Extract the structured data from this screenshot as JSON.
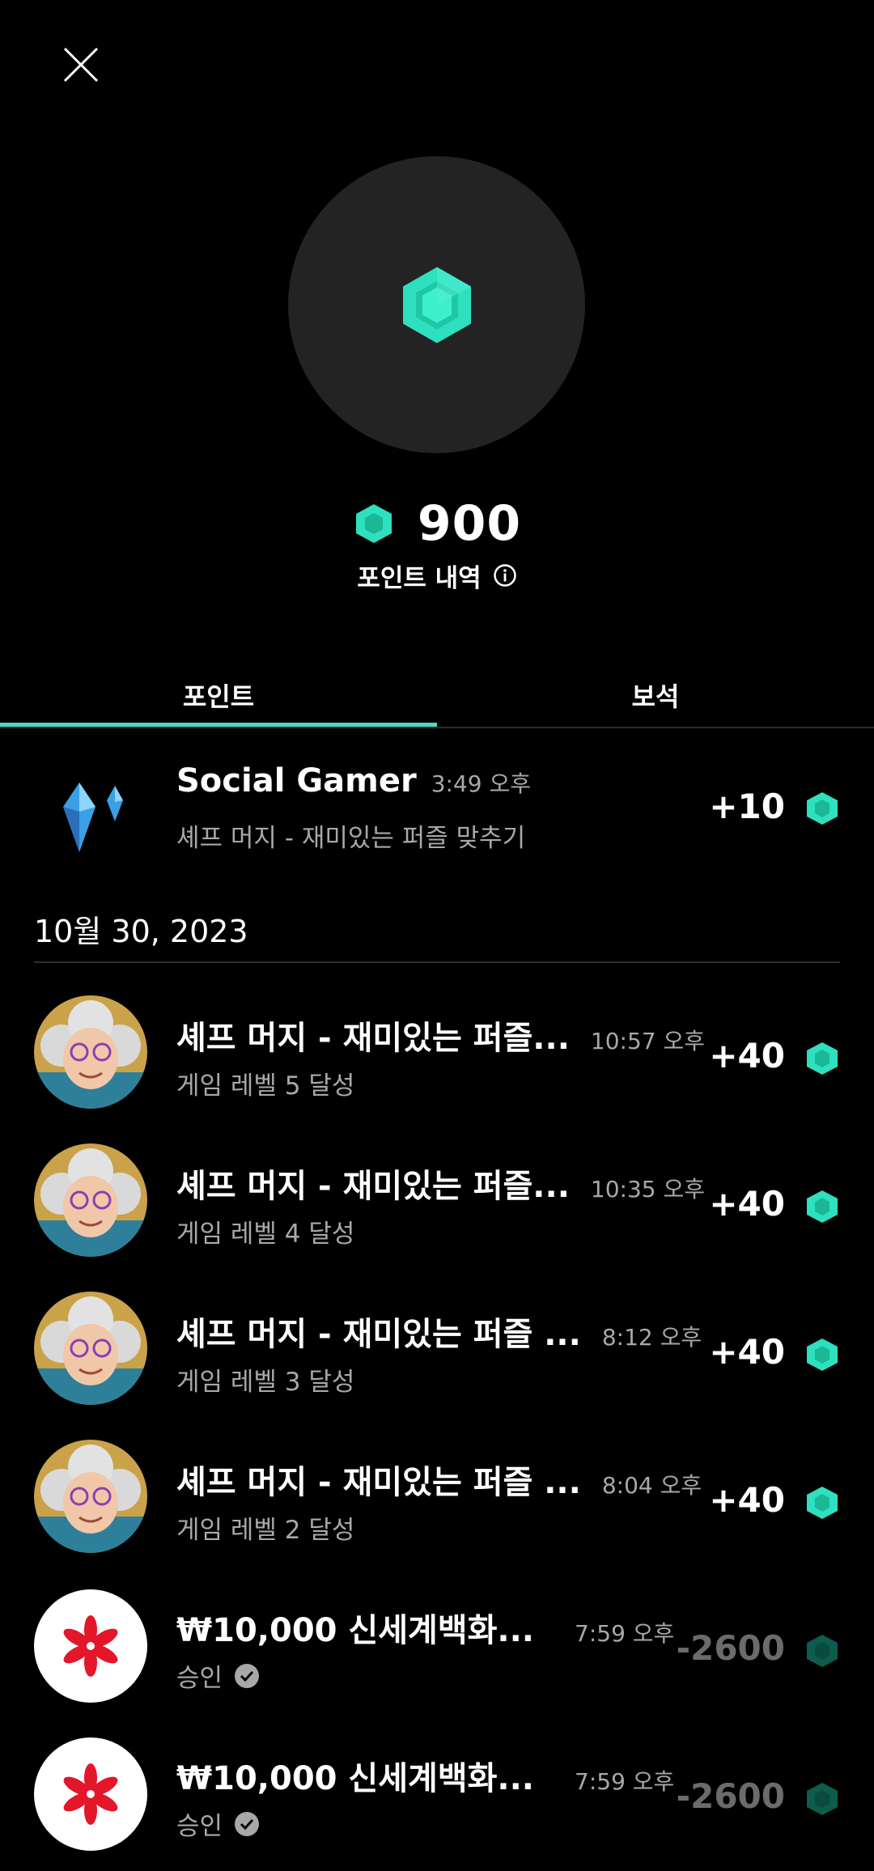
{
  "header": {
    "close_icon": "close-icon"
  },
  "balance": {
    "value": "900",
    "history_label": "포인트 내역"
  },
  "tabs": [
    {
      "label": "포인트",
      "active": true
    },
    {
      "label": "보석",
      "active": false
    }
  ],
  "date_group": "10월 30, 2023",
  "colors": {
    "accent": "#4fd9c0",
    "gem": "#2ee0bf",
    "muted": "#a8a8a8"
  },
  "items": [
    {
      "title": "Social Gamer",
      "time": "3:49 오후",
      "subtitle": "셰프 머지 - 재미있는 퍼즐 맞추기",
      "amount": "+10",
      "icon": "crystal-icon"
    },
    {
      "title": "셰프 머지 - 재미있는 퍼즐...",
      "time": "10:57 오후",
      "subtitle": "게임 레벨 5 달성",
      "amount": "+40",
      "icon": "chef-avatar"
    },
    {
      "title": "셰프 머지 - 재미있는 퍼즐...",
      "time": "10:35 오후",
      "subtitle": "게임 레벨 4 달성",
      "amount": "+40",
      "icon": "chef-avatar"
    },
    {
      "title": "셰프 머지 - 재미있는 퍼즐 ...",
      "time": "8:12 오후",
      "subtitle": "게임 레벨 3 달성",
      "amount": "+40",
      "icon": "chef-avatar"
    },
    {
      "title": "셰프 머지 - 재미있는 퍼즐 ...",
      "time": "8:04 오후",
      "subtitle": "게임 레벨 2 달성",
      "amount": "+40",
      "icon": "chef-avatar"
    },
    {
      "title": "₩10,000 신세계백화...",
      "time": "7:59 오후",
      "subtitle": "승인",
      "amount": "-2600",
      "icon": "shinsegae-logo"
    },
    {
      "title": "₩10,000 신세계백화...",
      "time": "7:59 오후",
      "subtitle": "승인",
      "amount": "-2600",
      "icon": "shinsegae-logo"
    }
  ]
}
